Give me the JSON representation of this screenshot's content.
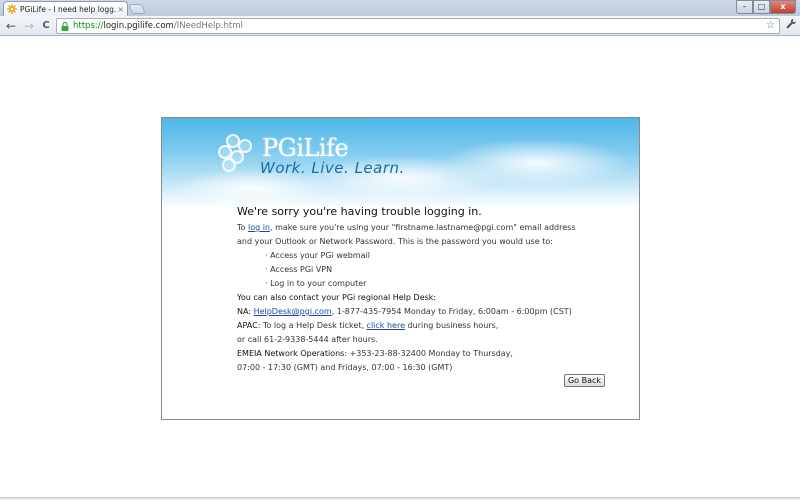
{
  "browser": {
    "tab_title": "PGiLife - I need help logg...",
    "tab_close": "×",
    "url_scheme": "https://",
    "url_host": "login.pgilife.com",
    "url_path": "/INeedHelp.html",
    "back": "←",
    "forward": "→",
    "reload": "C",
    "bookmark_star": "☆",
    "wrench": "🔧",
    "minimize": "–",
    "maximize": "□",
    "close": "x"
  },
  "banner": {
    "logo_text": "PGiLife",
    "tagline": "Work. Live. Learn."
  },
  "content": {
    "heading": "We're sorry you're having trouble logging in.",
    "intro_pre": "To ",
    "login_link": "log in",
    "intro_post": ", make sure you're using your \"firstname.lastname@pgi.com\" email address",
    "intro_line2": "and your Outlook or Network Password. This is the password you would use to:",
    "bullets": [
      "· Access your PGi webmail",
      "· Access PGi VPN",
      "· Log in to your computer"
    ],
    "contact_heading": "You can also contact your PGi regional Help Desk:",
    "na_label": "NA: ",
    "na_email": "HelpDesk@pgi.com",
    "na_rest": ", 1-877-435-7954 Monday to Friday, 6:00am - 6:00pm (CST)",
    "apac_label": "APAC",
    "apac_pre": ": To log a Help Desk ticket, ",
    "apac_link": "click here",
    "apac_post": " during business hours,",
    "apac_line2": "or call 61-2-9338-5444 after hours.",
    "emeia_label": "EMEIA Network Operations",
    "emeia_rest": ": +353-23-88-32400 Monday to Thursday,",
    "emeia_line2": "07:00 - 17:30 (GMT) and Fridays, 07:00 - 16:30 (GMT)",
    "go_back": "Go Back"
  }
}
